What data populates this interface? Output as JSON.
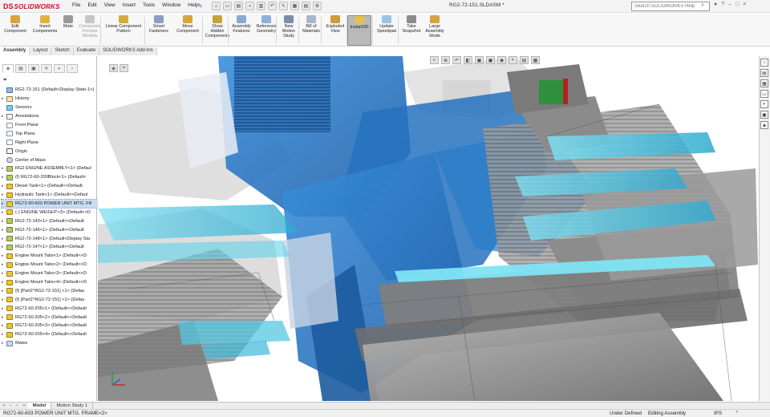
{
  "app": {
    "name": "SOLIDWORKS",
    "logo_mark": "DS"
  },
  "menu": [
    "File",
    "Edit",
    "View",
    "Insert",
    "Tools",
    "Window",
    "Help"
  ],
  "document_title": "RG2-72-151.SLDASM *",
  "help_search": {
    "placeholder": "Search SOLIDWORKS Help"
  },
  "commands": [
    {
      "label": "Edit\nComponent",
      "color": "#d9a43b",
      "disabled": false,
      "active": false
    },
    {
      "label": "Insert\nComponents",
      "color": "#e0b23f",
      "disabled": false,
      "active": false
    },
    {
      "label": "Mate",
      "color": "#9a9a9a",
      "disabled": false,
      "active": false
    },
    {
      "label": "Component\nPreview\nWindow",
      "color": "#c6c6c6",
      "disabled": true,
      "active": false
    },
    {
      "label": "Linear Component\nPattern",
      "color": "#d4ac3c",
      "disabled": false,
      "active": false
    },
    {
      "label": "Smart\nFasteners",
      "color": "#8aa0c0",
      "disabled": false,
      "active": false
    },
    {
      "label": "Move\nComponent",
      "color": "#d6a53c",
      "disabled": false,
      "active": false
    },
    {
      "label": "Show\nHidden\nComponents",
      "color": "#c9a13a",
      "disabled": false,
      "active": false
    },
    {
      "label": "Assembly\nFeatures",
      "color": "#8aa9d1",
      "disabled": false,
      "active": false
    },
    {
      "label": "Reference\nGeometry",
      "color": "#8fb0d8",
      "disabled": false,
      "active": false
    },
    {
      "label": "New\nMotion\nStudy",
      "color": "#7d8fa8",
      "disabled": false,
      "active": false
    },
    {
      "label": "Bill of\nMaterials",
      "color": "#a6b7cc",
      "disabled": false,
      "active": false
    },
    {
      "label": "Exploded\nView",
      "color": "#d09c38",
      "disabled": false,
      "active": false
    },
    {
      "label": "Instant3D",
      "color": "#e6c04a",
      "disabled": false,
      "active": true
    },
    {
      "label": "Update\nSpeedpak",
      "color": "#9ec2e2",
      "disabled": false,
      "active": false
    },
    {
      "label": "Take\nSnapshot",
      "color": "#8c8c8c",
      "disabled": false,
      "active": false
    },
    {
      "label": "Large\nAssembly\nMode",
      "color": "#d8a33c",
      "disabled": false,
      "active": false
    }
  ],
  "tabs": [
    {
      "label": "Assembly",
      "active": true
    },
    {
      "label": "Layout",
      "active": false
    },
    {
      "label": "Sketch",
      "active": false
    },
    {
      "label": "Evaluate",
      "active": false
    },
    {
      "label": "SOLIDWORKS Add-Ins",
      "active": false
    }
  ],
  "tree": [
    {
      "label": "RG2-72-151  (Default<Display State-1>)",
      "icon": "root",
      "arrow": "",
      "selected": false
    },
    {
      "label": "History",
      "icon": "hist",
      "arrow": "▸",
      "selected": false
    },
    {
      "label": "Sensors",
      "icon": "sens",
      "arrow": "",
      "selected": false
    },
    {
      "label": "Annotations",
      "icon": "ann",
      "arrow": "▸",
      "selected": false
    },
    {
      "label": "Front Plane",
      "icon": "plane",
      "arrow": "",
      "selected": false
    },
    {
      "label": "Top Plane",
      "icon": "plane",
      "arrow": "",
      "selected": false
    },
    {
      "label": "Right Plane",
      "icon": "plane",
      "arrow": "",
      "selected": false
    },
    {
      "label": "Origin",
      "icon": "org",
      "arrow": "",
      "selected": false
    },
    {
      "label": "Center of Mass",
      "icon": "mass",
      "arrow": "",
      "selected": false
    },
    {
      "label": "RG2 ENGINE ASSEMBLY<1> (Defaul",
      "icon": "comp",
      "arrow": "▸",
      "selected": false
    },
    {
      "label": "(f) RG72-60-200Block<1> (Default<",
      "icon": "comp",
      "arrow": "▸",
      "selected": false
    },
    {
      "label": "Diesel Tank<1> (Default<<Default",
      "icon": "yel",
      "arrow": "▸",
      "selected": false
    },
    {
      "label": "Hydraulic Tank<1> (Default<<Defaul",
      "icon": "yel",
      "arrow": "▸",
      "selected": false
    },
    {
      "label": "RG72-60-603 POWER UNIT MTG. FR",
      "icon": "yel",
      "arrow": "▸",
      "selected": true
    },
    {
      "label": "(-) ENGINE WEIGHT<3> (Default<<D",
      "icon": "yel",
      "arrow": "▸",
      "selected": false
    },
    {
      "label": "RG2-72-143<1> (Default<<Default",
      "icon": "comp",
      "arrow": "▸",
      "selected": false
    },
    {
      "label": "RG2-72-146<1> (Default<<Default",
      "icon": "comp",
      "arrow": "▸",
      "selected": false
    },
    {
      "label": "RG2-72-148<1> (Default<Display Sta",
      "icon": "comp",
      "arrow": "▸",
      "selected": false
    },
    {
      "label": "RG2-72-147<1> (Default<<Default",
      "icon": "comp",
      "arrow": "▸",
      "selected": false
    },
    {
      "label": "Engine Mount Tabs<1> (Default<<D",
      "icon": "yel",
      "arrow": "▸",
      "selected": false
    },
    {
      "label": "Engine Mount Tabs<2> (Default<<D",
      "icon": "yel",
      "arrow": "▸",
      "selected": false
    },
    {
      "label": "Engine Mount Tabs<3> (Default<<D",
      "icon": "yel",
      "arrow": "▸",
      "selected": false
    },
    {
      "label": "Engine Mount Tabs<4> (Default<<D",
      "icon": "yel",
      "arrow": "▸",
      "selected": false
    },
    {
      "label": "(f) [Part2^RG2-72-151] <1> (Defau",
      "icon": "yel",
      "arrow": "▸",
      "selected": false
    },
    {
      "label": "(f) [Part2^RG2-72-151] <1> (Defau",
      "icon": "yel",
      "arrow": "▸",
      "selected": false
    },
    {
      "label": "RG72-60-205<1> (Default<<Default",
      "icon": "yel",
      "arrow": "▸",
      "selected": false
    },
    {
      "label": "RG72-60-205<2> (Default<<Default",
      "icon": "yel",
      "arrow": "▸",
      "selected": false
    },
    {
      "label": "RG72-60-205<3> (Default<<Default",
      "icon": "yel",
      "arrow": "▸",
      "selected": false
    },
    {
      "label": "RG72-60-205<4> (Default<<Default",
      "icon": "yel",
      "arrow": "▸",
      "selected": false
    },
    {
      "label": "Mates",
      "icon": "mate",
      "arrow": "▸",
      "selected": false
    }
  ],
  "bottom_tabs": [
    {
      "label": "Model",
      "active": true
    },
    {
      "label": "Motion Study 1",
      "active": false
    }
  ],
  "status": {
    "selection": "RG72-60-603 POWER UNIT MTG. FRAME<2>",
    "definition": "Under Defined",
    "mode": "Editing Assembly",
    "units": "IPS"
  },
  "colors": {
    "accent_blue": "#2f7fd0",
    "highlight_cyan": "#3fc2df",
    "steel_gray": "#8f8f8f",
    "brand_red": "#c8102e"
  }
}
